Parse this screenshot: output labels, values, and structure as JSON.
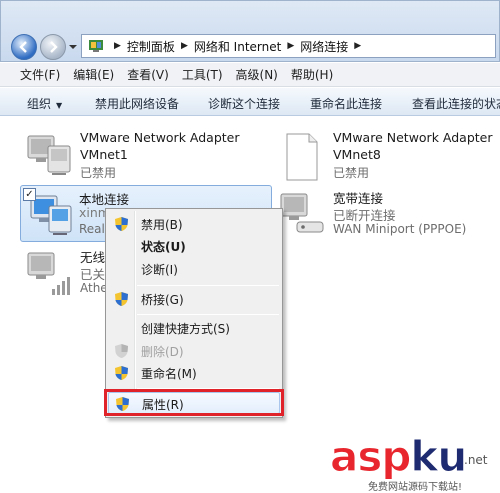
{
  "address": {
    "crumbs": [
      "控制面板",
      "网络和 Internet",
      "网络连接"
    ]
  },
  "menubar": {
    "items": [
      "文件(F)",
      "编辑(E)",
      "查看(V)",
      "工具(T)",
      "高级(N)",
      "帮助(H)"
    ]
  },
  "cmdbar": {
    "organize": "组织",
    "disable": "禁用此网络设备",
    "diagnose": "诊断这个连接",
    "rename": "重命名此连接",
    "status": "查看此连接的状态"
  },
  "connections": [
    {
      "name": "VMware Network Adapter",
      "device": "VMnet1",
      "status": "已禁用"
    },
    {
      "name": "VMware Network Adapter",
      "device": "VMnet8",
      "status": "已禁用"
    },
    {
      "name": "本地连接",
      "device": "xinm",
      "status": "Real"
    },
    {
      "name": "宽带连接",
      "device": "已断开连接",
      "status": "WAN Miniport (PPPOE)"
    },
    {
      "name": "无线",
      "device": "已关",
      "status": "Athe"
    }
  ],
  "context_menu": {
    "disable": "禁用(B)",
    "status": "状态(U)",
    "diagnose": "诊断(I)",
    "bridge": "桥接(G)",
    "shortcut": "创建快捷方式(S)",
    "delete": "删除(D)",
    "rename": "重命名(M)",
    "properties": "属性(R)"
  },
  "watermark": {
    "brand_a": "asp",
    "brand_b": "ku",
    "tld": ".net",
    "sub": "免费网站源码下载站!"
  },
  "colors": {
    "highlight_box": "#e0222b",
    "selection": "#cfe3f8",
    "brand_red": "#e8262d",
    "brand_blue": "#1f2b70"
  }
}
